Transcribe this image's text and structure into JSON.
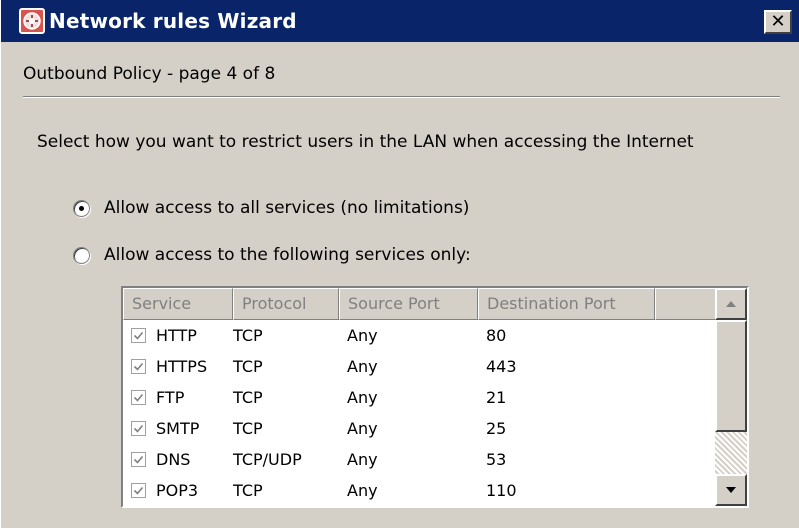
{
  "window": {
    "title": "Network rules Wizard",
    "close_glyph": "✕"
  },
  "page": {
    "header": "Outbound Policy - page 4 of 8",
    "instructions": "Select how you want to restrict users in the LAN when accessing the Internet"
  },
  "radios": [
    {
      "label": "Allow access to all services (no limitations)",
      "checked": true
    },
    {
      "label": "Allow access to the following services only:",
      "checked": false
    }
  ],
  "services": {
    "columns": [
      "Service",
      "Protocol",
      "Source Port",
      "Destination Port"
    ],
    "rows": [
      {
        "checked": true,
        "service": "HTTP",
        "protocol": "TCP",
        "source_port": "Any",
        "destination_port": "80"
      },
      {
        "checked": true,
        "service": "HTTPS",
        "protocol": "TCP",
        "source_port": "Any",
        "destination_port": "443"
      },
      {
        "checked": true,
        "service": "FTP",
        "protocol": "TCP",
        "source_port": "Any",
        "destination_port": "21"
      },
      {
        "checked": true,
        "service": "SMTP",
        "protocol": "TCP",
        "source_port": "Any",
        "destination_port": "25"
      },
      {
        "checked": true,
        "service": "DNS",
        "protocol": "TCP/UDP",
        "source_port": "Any",
        "destination_port": "53"
      },
      {
        "checked": true,
        "service": "POP3",
        "protocol": "TCP",
        "source_port": "Any",
        "destination_port": "110"
      }
    ]
  },
  "icons": {
    "app": "network-wizard-icon",
    "close": "close-icon",
    "scroll_up": "scroll-up-arrow-icon",
    "scroll_down": "scroll-down-arrow-icon",
    "checkbox": "checkmark-icon"
  },
  "colors": {
    "titlebar": "#0a246a",
    "dialog_background": "#d4d0c8",
    "disabled_text": "#808080"
  }
}
